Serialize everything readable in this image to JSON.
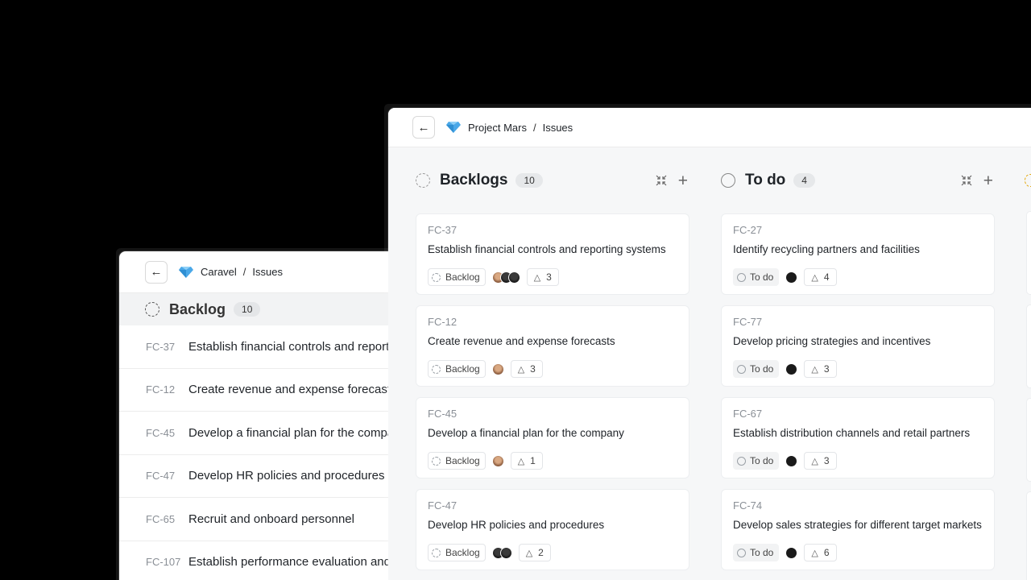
{
  "list_window": {
    "breadcrumb": {
      "project": "Caravel",
      "separator": "/",
      "page": "Issues"
    },
    "group": {
      "title": "Backlog",
      "count": "10"
    },
    "rows": [
      {
        "id": "FC-37",
        "title": "Establish financial controls and reporting systems"
      },
      {
        "id": "FC-12",
        "title": "Create revenue and expense forecasts"
      },
      {
        "id": "FC-45",
        "title": "Develop a financial plan for the company"
      },
      {
        "id": "FC-47",
        "title": "Develop HR policies and procedures"
      },
      {
        "id": "FC-65",
        "title": "Recruit and onboard personnel"
      },
      {
        "id": "FC-107",
        "title": "Establish performance evaluation and feedback"
      }
    ]
  },
  "board_window": {
    "breadcrumb": {
      "project": "Project Mars",
      "separator": "/",
      "page": "Issues"
    },
    "columns": [
      {
        "title": "Backlogs",
        "count": "10",
        "cards": [
          {
            "id": "FC-37",
            "title": "Establish financial controls and reporting systems",
            "status": "Backlog",
            "avatars": [
              "tan",
              "dark",
              "dark"
            ],
            "priority": "3"
          },
          {
            "id": "FC-12",
            "title": "Create revenue and expense forecasts",
            "status": "Backlog",
            "avatars": [
              "tan"
            ],
            "priority": "3"
          },
          {
            "id": "FC-45",
            "title": "Develop a financial plan for the company",
            "status": "Backlog",
            "avatars": [
              "tan"
            ],
            "priority": "1"
          },
          {
            "id": "FC-47",
            "title": "Develop HR policies and procedures",
            "status": "Backlog",
            "avatars": [
              "dark",
              "dark"
            ],
            "priority": "2"
          }
        ]
      },
      {
        "title": "To do",
        "count": "4",
        "cards": [
          {
            "id": "FC-27",
            "title": "Identify recycling partners and facilities",
            "status": "To do",
            "avatars": [
              "black"
            ],
            "priority": "4"
          },
          {
            "id": "FC-77",
            "title": "Develop pricing strategies and incentives",
            "status": "To do",
            "avatars": [
              "black"
            ],
            "priority": "3"
          },
          {
            "id": "FC-67",
            "title": "Establish distribution channels and retail partners",
            "status": "To do",
            "avatars": [
              "black"
            ],
            "priority": "3"
          },
          {
            "id": "FC-74",
            "title": "Develop sales strategies for different target markets",
            "status": "To do",
            "avatars": [
              "black"
            ],
            "priority": "6"
          }
        ]
      }
    ]
  },
  "icons": {
    "back": "arrow-left-icon",
    "project": "diamond-icon",
    "collapse": "collapse-arrows-icon",
    "add": "plus-icon",
    "priority": "triangle-icon",
    "backlog_status": "dashed-circle-icon",
    "todo_status": "circle-icon"
  },
  "colors": {
    "diamond": "#4aa8e8",
    "in_progress_ring": "#e2a400"
  }
}
